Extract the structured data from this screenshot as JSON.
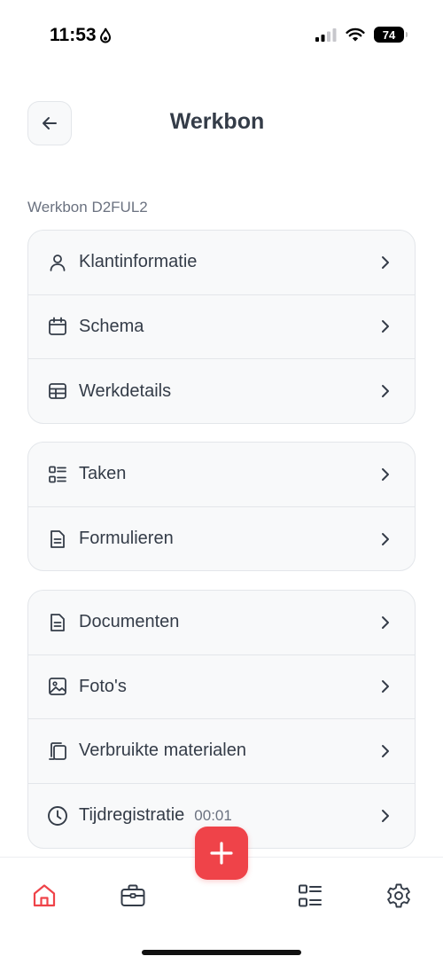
{
  "status_bar": {
    "time": "11:53",
    "battery": "74"
  },
  "header": {
    "title": "Werkbon"
  },
  "section_label": "Werkbon D2FUL2",
  "groups": [
    {
      "items": [
        {
          "label": "Klantinformatie",
          "icon": "user-icon"
        },
        {
          "label": "Schema",
          "icon": "calendar-icon"
        },
        {
          "label": "Werkdetails",
          "icon": "table-icon"
        }
      ]
    },
    {
      "items": [
        {
          "label": "Taken",
          "icon": "task-list-icon"
        },
        {
          "label": "Formulieren",
          "icon": "form-document-icon"
        }
      ]
    },
    {
      "items": [
        {
          "label": "Documenten",
          "icon": "document-icon"
        },
        {
          "label": "Foto's",
          "icon": "image-icon"
        },
        {
          "label": "Verbruikte materialen",
          "icon": "materials-icon"
        },
        {
          "label": "Tijdregistratie",
          "icon": "clock-icon",
          "extra": "00:01"
        }
      ]
    }
  ],
  "colors": {
    "accent": "#ef4349",
    "text": "#343c48",
    "muted": "#6b7280",
    "card_bg": "#f8f9fa",
    "border": "#e3e6ea"
  },
  "bottom_nav": {
    "active": "home",
    "items": [
      "home-icon",
      "briefcase-icon",
      "add-icon",
      "task-list-icon",
      "gear-icon"
    ]
  }
}
